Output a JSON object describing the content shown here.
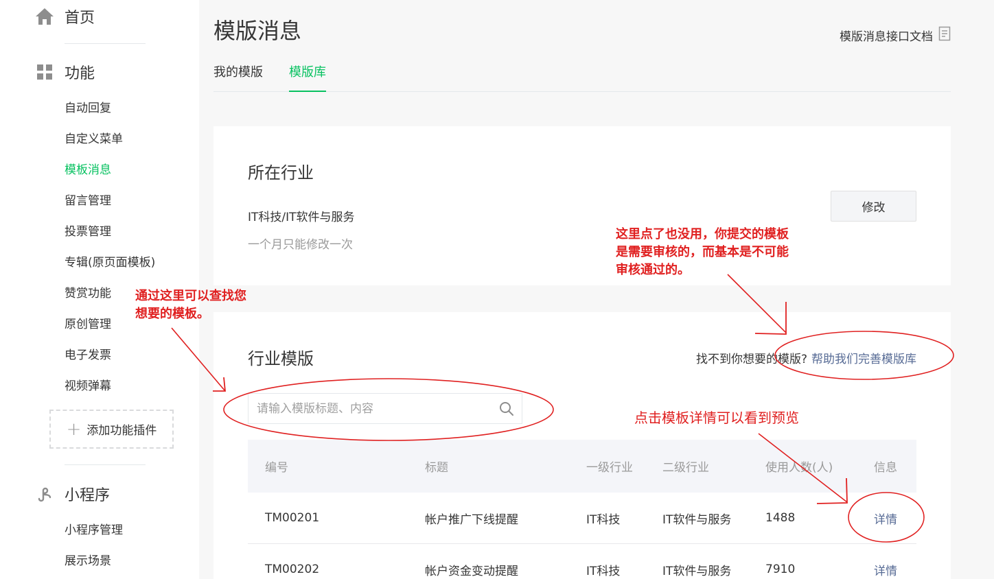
{
  "sidebar": {
    "home_label": "首页",
    "functions_label": "功能",
    "items": [
      {
        "label": "自动回复",
        "active": false
      },
      {
        "label": "自定义菜单",
        "active": false
      },
      {
        "label": "模板消息",
        "active": true
      },
      {
        "label": "留言管理",
        "active": false
      },
      {
        "label": "投票管理",
        "active": false
      },
      {
        "label": "专辑(原页面模板)",
        "active": false
      },
      {
        "label": "赞赏功能",
        "active": false
      },
      {
        "label": "原创管理",
        "active": false
      },
      {
        "label": "电子发票",
        "active": false
      },
      {
        "label": "视频弹幕",
        "active": false
      }
    ],
    "add_plugin_label": "添加功能插件",
    "miniprogram_label": "小程序",
    "miniprogram_items": [
      {
        "label": "小程序管理"
      },
      {
        "label": "展示场景"
      }
    ]
  },
  "header": {
    "title": "模版消息",
    "doc_link": "模版消息接口文档",
    "tabs": [
      {
        "label": "我的模版",
        "active": false
      },
      {
        "label": "模版库",
        "active": true
      }
    ]
  },
  "industry": {
    "heading": "所在行业",
    "value": "IT科技/IT软件与服务",
    "note": "一个月只能修改一次",
    "modify_button": "修改"
  },
  "templates": {
    "heading": "行业模版",
    "help_text": "找不到你想要的模版?",
    "help_link": "帮助我们完善模版库",
    "search_placeholder": "请输入模版标题、内容",
    "columns": [
      "编号",
      "标题",
      "一级行业",
      "二级行业",
      "使用人数(人)",
      "信息"
    ],
    "rows": [
      {
        "id": "TM00201",
        "title": "帐户推广下线提醒",
        "industry1": "IT科技",
        "industry2": "IT软件与服务",
        "users": "1488",
        "info": "详情"
      },
      {
        "id": "TM00202",
        "title": "帐户资金变动提醒",
        "industry1": "IT科技",
        "industry2": "IT软件与服务",
        "users": "7910",
        "info": "详情"
      }
    ]
  },
  "annotations": {
    "search_note": [
      "通过这里可以查找您",
      "想要的模板。"
    ],
    "modify_note": [
      "这里点了也没用，你提交的模板",
      "是需要审核的，而基本是不可能",
      "审核通过的。"
    ],
    "detail_note": "点击模板详情可以看到预览",
    "color": "#e02020"
  },
  "colors": {
    "accent": "#07c160",
    "link": "#576b95"
  }
}
